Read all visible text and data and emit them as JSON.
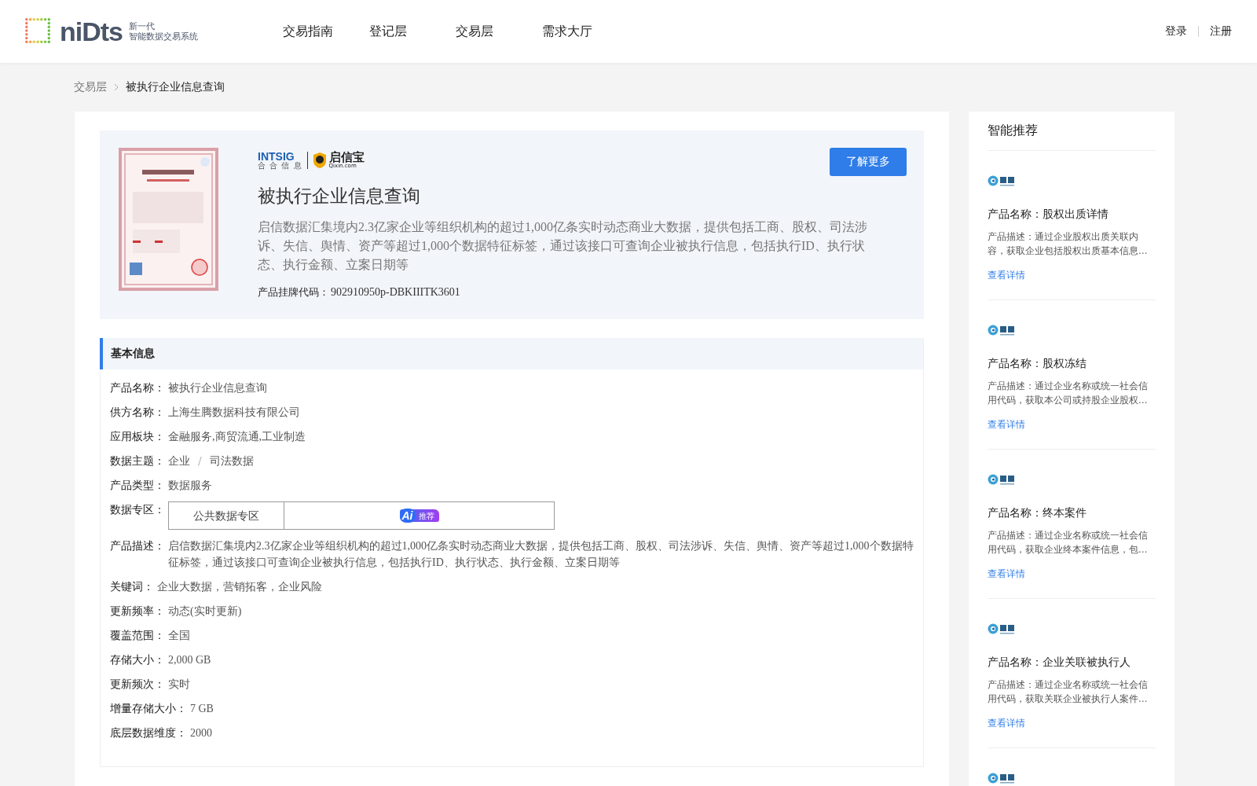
{
  "header": {
    "logo": {
      "mark": "niDts",
      "line1": "新一代",
      "line2": "智能数据交易系统"
    },
    "nav": [
      {
        "label": "交易指南",
        "selected": false
      },
      {
        "label": "登记层",
        "selected": false
      },
      {
        "label": "交易层",
        "selected": false
      },
      {
        "label": "需求大厅",
        "selected": false
      }
    ],
    "auth": [
      "登录",
      "注册"
    ]
  },
  "breadcrumb": [
    "交易层",
    "被执行企业信息查询"
  ],
  "product": {
    "partner_logo": {
      "brand1": "INTSIG",
      "brand1_sub": "合 合 信 息",
      "brand2": "启信宝",
      "brand2_sub": "Qixin.com"
    },
    "title": "被执行企业信息查询",
    "description": "启信数据汇集境内2.3亿家企业等组织机构的超过1,000亿条实时动态商业大数据，提供包括工商、股权、司法涉诉、失信、舆情、资产等超过1,000个数据特征标签，通过该接口可查询企业被执行信息，包括执行ID、执行状态、执行金额、立案日期等",
    "code_label": "产品挂牌代码：",
    "code": "902910950p-DBKIIITK3601",
    "button": "了解更多"
  },
  "basic_info": {
    "title": "基本信息",
    "rows": [
      {
        "kind": "text",
        "label": "产品名称：",
        "value": "被执行企业信息查询"
      },
      {
        "kind": "text",
        "label": "供方名称：",
        "value": "上海生腾数据科技有限公司"
      },
      {
        "kind": "text",
        "label": "应用板块：",
        "value": "金融服务,商贸流通,工业制造"
      },
      {
        "kind": "path",
        "label": "数据主题：",
        "parts": [
          "企业",
          "司法数据"
        ],
        "separator": "/"
      },
      {
        "kind": "text",
        "label": "产品类型：",
        "value": "数据服务"
      },
      {
        "kind": "zone",
        "label": "数据专区：",
        "zone": "公共数据专区",
        "badge": {
          "ai": "Ai",
          "text": "推荐"
        }
      },
      {
        "kind": "text",
        "label": "产品描述：",
        "value": "启信数据汇集境内2.3亿家企业等组织机构的超过1,000亿条实时动态商业大数据，提供包括工商、股权、司法涉诉、失信、舆情、资产等超过1,000个数据特征标签，通过该接口可查询企业被执行信息，包括执行ID、执行状态、执行金额、立案日期等"
      },
      {
        "kind": "text",
        "label": "关键词：",
        "value": "企业大数据，营销拓客，企业风险"
      },
      {
        "kind": "text",
        "label": "更新频率：",
        "value": "动态(实时更新)"
      },
      {
        "kind": "text",
        "label": "覆盖范围：",
        "value": "全国"
      },
      {
        "kind": "text",
        "label": "存储大小：",
        "value": "2,000 GB"
      },
      {
        "kind": "text",
        "label": "更新频次：",
        "value": "实时"
      },
      {
        "kind": "text",
        "label": "增量存储大小：",
        "value": "7 GB"
      },
      {
        "kind": "text",
        "label": "底层数据维度：",
        "value": "2000"
      }
    ]
  },
  "recommend": {
    "title": "智能推荐",
    "items": [
      {
        "kind": "full",
        "name": "产品名称：股权出质详情",
        "desc": "产品描述：通过企业股权出质关联内容，获取企业包括股权出质基本信息…",
        "link": "查看详情"
      },
      {
        "kind": "full",
        "name": "产品名称：股权冻结",
        "desc": "产品描述：通过企业名称或统一社会信用代码，获取本公司或持股企业股权…",
        "link": "查看详情"
      },
      {
        "kind": "full",
        "name": "产品名称：终本案件",
        "desc": "产品描述：通过企业名称或统一社会信用代码，获取企业终本案件信息，包…",
        "link": "查看详情"
      },
      {
        "kind": "full",
        "name": "产品名称：企业关联被执行人",
        "desc": "产品描述：通过企业名称或统一社会信用代码，获取关联企业被执行人案件…",
        "link": "查看详情"
      },
      {
        "kind": "logo_only"
      }
    ]
  }
}
